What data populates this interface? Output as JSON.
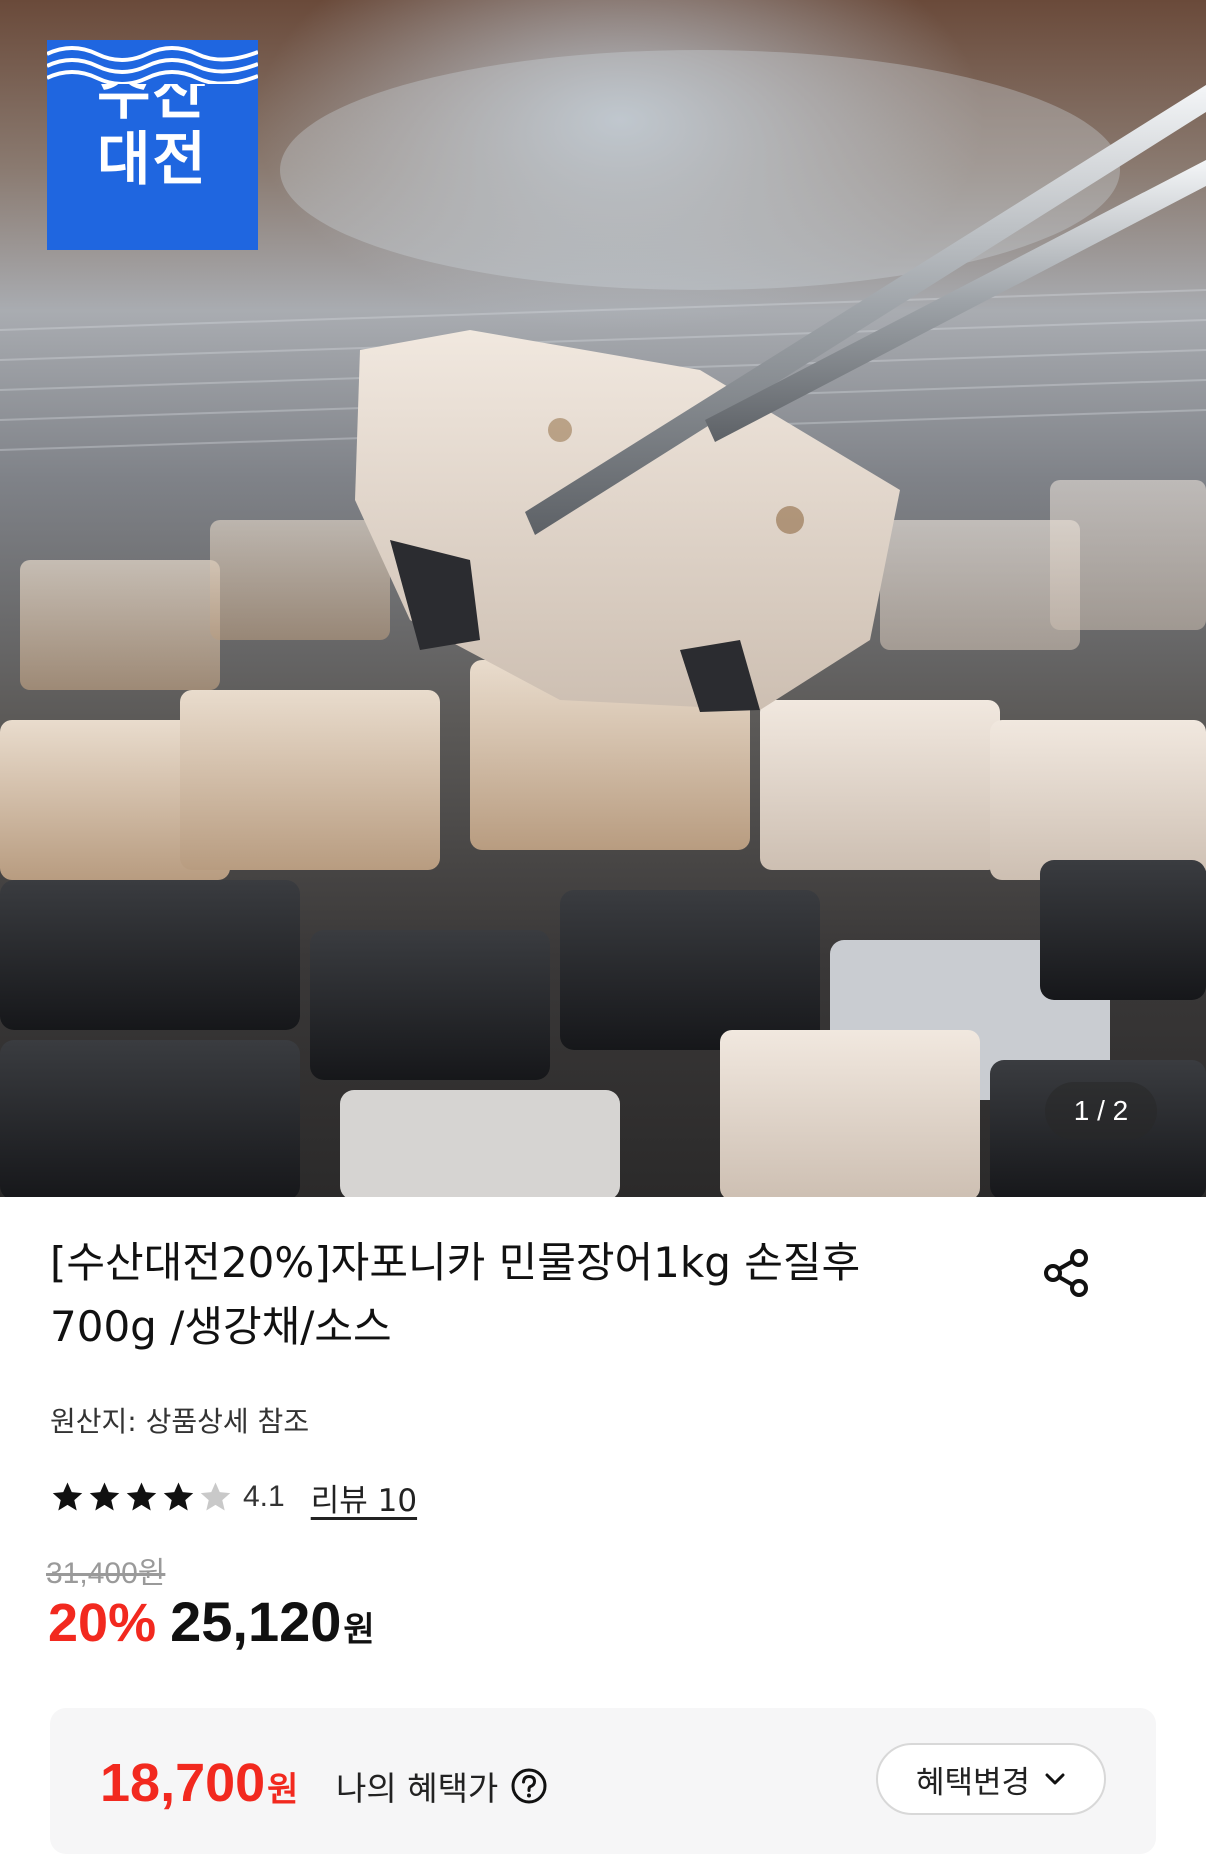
{
  "hero": {
    "brand_badge": {
      "line1": "수산",
      "line2": "대전"
    },
    "image_counter": "1 / 2"
  },
  "product": {
    "title": "[수산대전20%]자포니카 민물장어1kg 손질후 700g /생강채/소스",
    "origin": "원산지: 상품상세 참조",
    "rating": {
      "value": "4.1",
      "stars_filled": 4,
      "stars_total": 5
    },
    "review_link": "리뷰 10",
    "original_price": "31,400원",
    "discount_rate": "20%",
    "sale_price": "25,120",
    "sale_unit": "원"
  },
  "benefit": {
    "amount": "18,700",
    "unit": "원",
    "label": "나의 혜택가",
    "change_button": "혜택변경"
  },
  "colors": {
    "accent_red": "#f2291f",
    "brand_blue": "#1f66e0",
    "benefit_bg": "#f6f6f7"
  },
  "icons": [
    "share-icon",
    "star-icon",
    "help-icon",
    "chevron-down-icon"
  ]
}
